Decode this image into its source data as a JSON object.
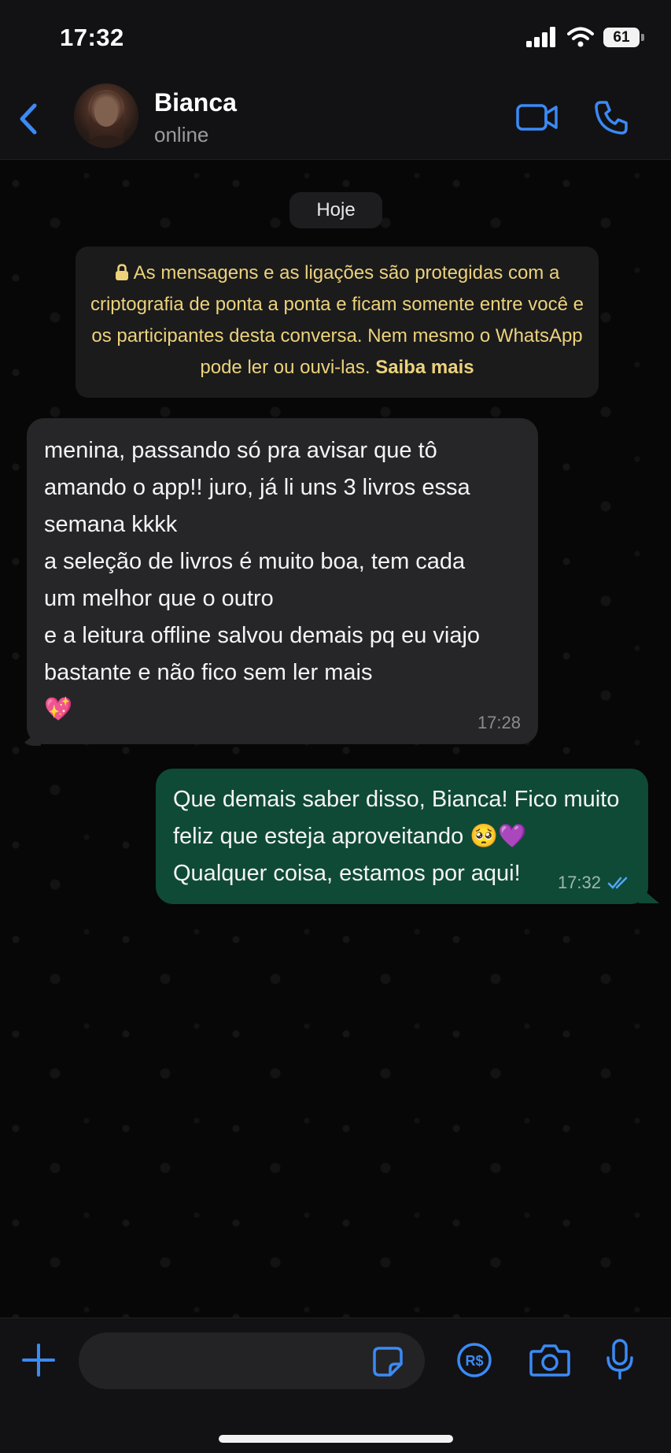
{
  "status_bar": {
    "time": "17:32",
    "battery": "61"
  },
  "header": {
    "contact_name": "Bianca",
    "contact_status": "online"
  },
  "chat": {
    "date_label": "Hoje",
    "encryption_notice": {
      "text": "As mensagens e as ligações são protegidas com a criptografia de ponta a ponta e ficam somente entre você e os participantes desta conversa. Nem mesmo o WhatsApp pode ler ou ouvi-las.",
      "link": "Saiba mais"
    },
    "messages": [
      {
        "direction": "incoming",
        "text": "menina, passando só pra avisar que tô\namando o app!! juro, já li uns 3 livros essa\nsemana kkkk\na seleção de livros é muito boa, tem cada\num melhor que o outro\ne a leitura offline salvou demais pq eu viajo\nbastante e não fico sem ler mais\n💖",
        "time": "17:28"
      },
      {
        "direction": "outgoing",
        "text": "Que demais saber disso, Bianca! Fico muito\nfeliz que esteja aproveitando 🥺💜\nQualquer coisa, estamos por aqui!",
        "time": "17:32",
        "status": "read"
      }
    ]
  },
  "composer": {
    "placeholder": ""
  },
  "icons": {
    "back": "chevron-left-icon",
    "video": "video-camera-icon",
    "call": "phone-icon",
    "plus": "plus-icon",
    "sticker": "sticker-icon",
    "pay": "payment-brl-icon",
    "camera": "camera-icon",
    "mic": "microphone-icon",
    "lock": "lock-icon",
    "read": "double-check-icon"
  },
  "colors": {
    "accent": "#3b8af6",
    "outgoing_bubble": "#0f4a36",
    "incoming_bubble": "#262628",
    "notice_text": "#ecd27b",
    "read_ticks": "#53a6f7"
  }
}
